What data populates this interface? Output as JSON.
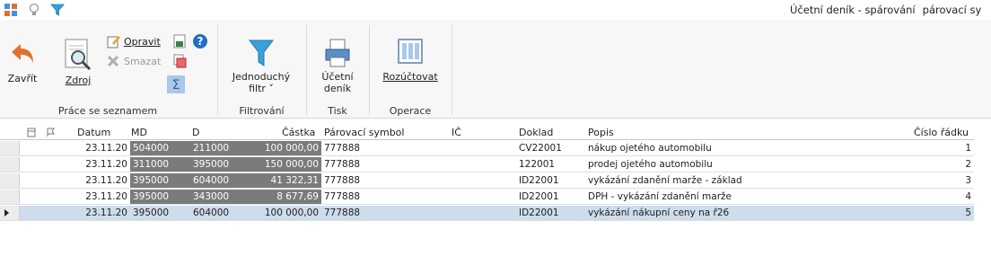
{
  "window": {
    "title": "Účetní deník - spárování",
    "subtitle": "párovací sy",
    "quick_access": [
      "app-icon",
      "lightbulb-icon",
      "filter-icon"
    ]
  },
  "ribbon": {
    "zavrit": "Zavřít",
    "zdroj": "Zdroj",
    "opravit": "Opravit",
    "smazat": "Smazat",
    "group_prace": "Práce se seznamem",
    "jednoduchy_1": "Jednoduchý",
    "jednoduchy_2": "filtr ˅",
    "group_filtrovani": "Filtrování",
    "ucetni_1": "Účetní",
    "ucetni_2": "deník",
    "group_tisk": "Tisk",
    "rozuctovat": "Rozúčtovat",
    "group_operace": "Operace",
    "colors": {
      "back_arrow": "#e0712c",
      "help": "#1f6fc4",
      "filter": "#3aa0d8"
    }
  },
  "grid": {
    "columns": [
      "Datum",
      "MD",
      "D",
      "Částka",
      "Párovací symbol",
      "IČ",
      "Doklad",
      "Popis",
      "Číslo řádku"
    ],
    "rows": [
      {
        "datum": "23.11.20",
        "md": "504000",
        "d": "211000",
        "castka": "100 000,00",
        "parovaci": "777888",
        "ic": "",
        "doklad": "CV22001",
        "popis": "nákup ojetého automobilu",
        "cislo": "1"
      },
      {
        "datum": "23.11.20",
        "md": "311000",
        "d": "395000",
        "castka": "150 000,00",
        "parovaci": "777888",
        "ic": "",
        "doklad": "122001",
        "popis": "prodej ojetého automobilu",
        "cislo": "2"
      },
      {
        "datum": "23.11.20",
        "md": "395000",
        "d": "604000",
        "castka": "41 322,31",
        "parovaci": "777888",
        "ic": "",
        "doklad": "ID22001",
        "popis": "vykázání zdanění marže - základ",
        "cislo": "3"
      },
      {
        "datum": "23.11.20",
        "md": "395000",
        "d": "343000",
        "castka": "8 677,69",
        "parovaci": "777888",
        "ic": "",
        "doklad": "ID22001",
        "popis": "DPH - vykázání zdanění marže",
        "cislo": "4"
      },
      {
        "datum": "23.11.20",
        "md": "395000",
        "d": "604000",
        "castka": "100 000,00",
        "parovaci": "777888",
        "ic": "",
        "doklad": "ID22001",
        "popis": "vykázání nákupní ceny na ř26",
        "cislo": "5"
      }
    ]
  }
}
